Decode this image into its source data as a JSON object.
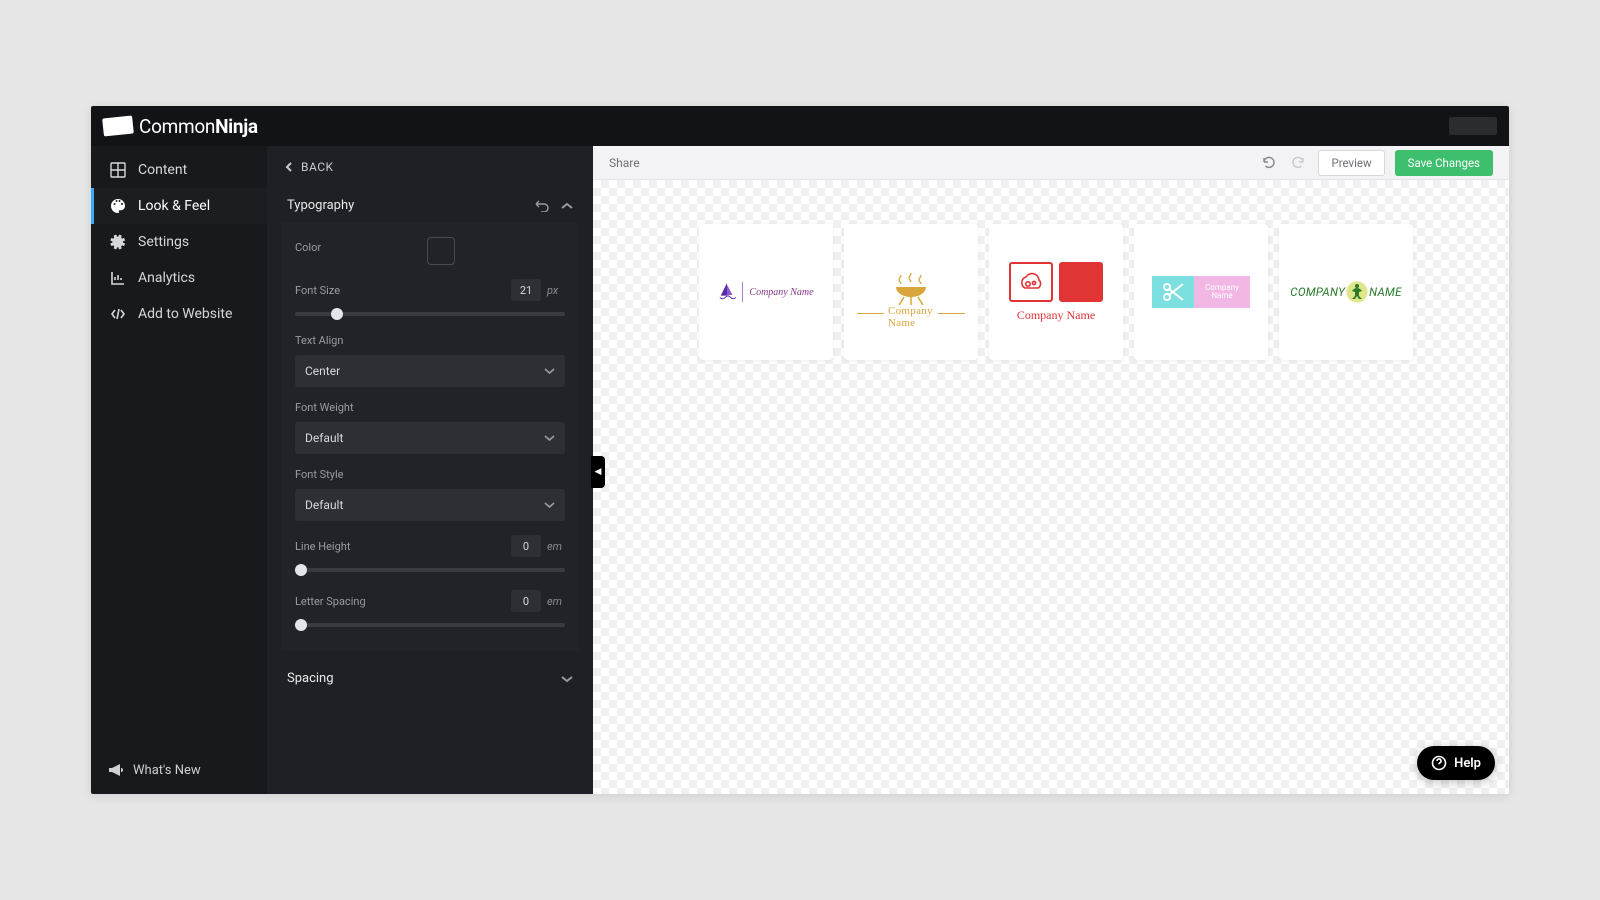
{
  "brand": {
    "name_a": "Common",
    "name_b": "Ninja"
  },
  "nav": {
    "items": [
      {
        "label": "Content"
      },
      {
        "label": "Look & Feel"
      },
      {
        "label": "Settings"
      },
      {
        "label": "Analytics"
      },
      {
        "label": "Add to Website"
      }
    ],
    "footer": "What's New"
  },
  "panel": {
    "back": "BACK",
    "sections": {
      "typography": {
        "title": "Typography"
      },
      "spacing": {
        "title": "Spacing"
      }
    },
    "props": {
      "color_label": "Color",
      "font_size_label": "Font Size",
      "font_size_value": "21",
      "font_size_unit": "px",
      "text_align_label": "Text Align",
      "text_align_value": "Center",
      "font_weight_label": "Font Weight",
      "font_weight_value": "Default",
      "font_style_label": "Font Style",
      "font_style_value": "Default",
      "line_height_label": "Line Height",
      "line_height_value": "0",
      "line_height_unit": "em",
      "letter_spacing_label": "Letter Spacing",
      "letter_spacing_value": "0",
      "letter_spacing_unit": "em"
    }
  },
  "toolbar": {
    "share": "Share",
    "preview": "Preview",
    "save": "Save Changes"
  },
  "logos": {
    "company_name": "Company Name",
    "l4_line1": "Company",
    "l4_line2": "Name",
    "l5_a": "COMPANY",
    "l5_b": "NAME"
  },
  "help": "Help",
  "colors": {
    "primary_green": "#3dbf6d",
    "accent_blue": "#3ba9ff"
  }
}
